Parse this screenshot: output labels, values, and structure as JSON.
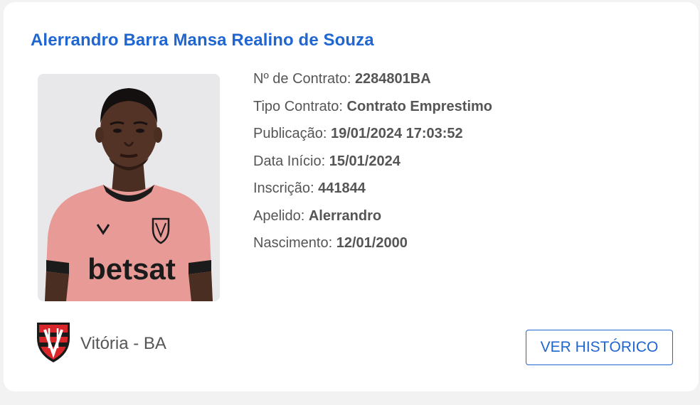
{
  "player": {
    "name": "Alerrandro Barra Mansa Realino de Souza",
    "photo_shirt_text": "betsat"
  },
  "details": [
    {
      "label": "Nº de Contrato: ",
      "value": "2284801BA"
    },
    {
      "label": "Tipo Contrato: ",
      "value": "Contrato Emprestimo"
    },
    {
      "label": "Publicação: ",
      "value": "19/01/2024 17:03:52"
    },
    {
      "label": "Data Início: ",
      "value": "15/01/2024"
    },
    {
      "label": "Inscrição: ",
      "value": "441844"
    },
    {
      "label": "Apelido: ",
      "value": "Alerrandro"
    },
    {
      "label": "Nascimento: ",
      "value": "12/01/2000"
    }
  ],
  "club": {
    "name": "Vitória - BA",
    "crest_icon": "club-crest-icon"
  },
  "actions": {
    "history_label": "VER HISTÓRICO"
  },
  "colors": {
    "accent": "#1f66d1",
    "text": "#555555",
    "background": "#f2f2f2",
    "card": "#ffffff"
  }
}
